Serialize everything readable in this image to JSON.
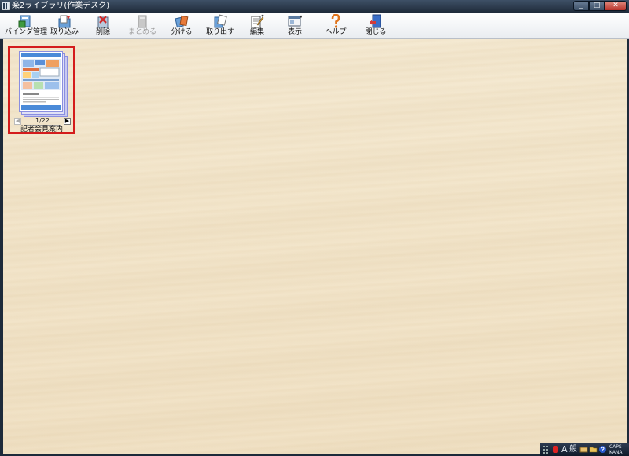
{
  "window": {
    "title": "楽2ライブラリ(作業デスク)",
    "minimize": "_",
    "maximize": "□",
    "close": "✕"
  },
  "toolbar": {
    "binder_manage": "バインダ管理",
    "import": "取り込み",
    "delete": "削除",
    "merge": "まとめる",
    "split": "分ける",
    "export": "取り出す",
    "edit": "編集",
    "view": "表示",
    "help": "ヘルプ",
    "close": "閉じる"
  },
  "binder": {
    "name": "記者会見案内",
    "page_indicator": "1/22",
    "prev": "◀",
    "next": "▶"
  },
  "tray": {
    "ime_mode": "A",
    "ime_label": "般",
    "line1": "CAPS",
    "line2": "KANA"
  },
  "colors": {
    "selection_border": "#d41c1c",
    "titlebar": "#1f2b3a",
    "desk": "#f3e6cc"
  }
}
